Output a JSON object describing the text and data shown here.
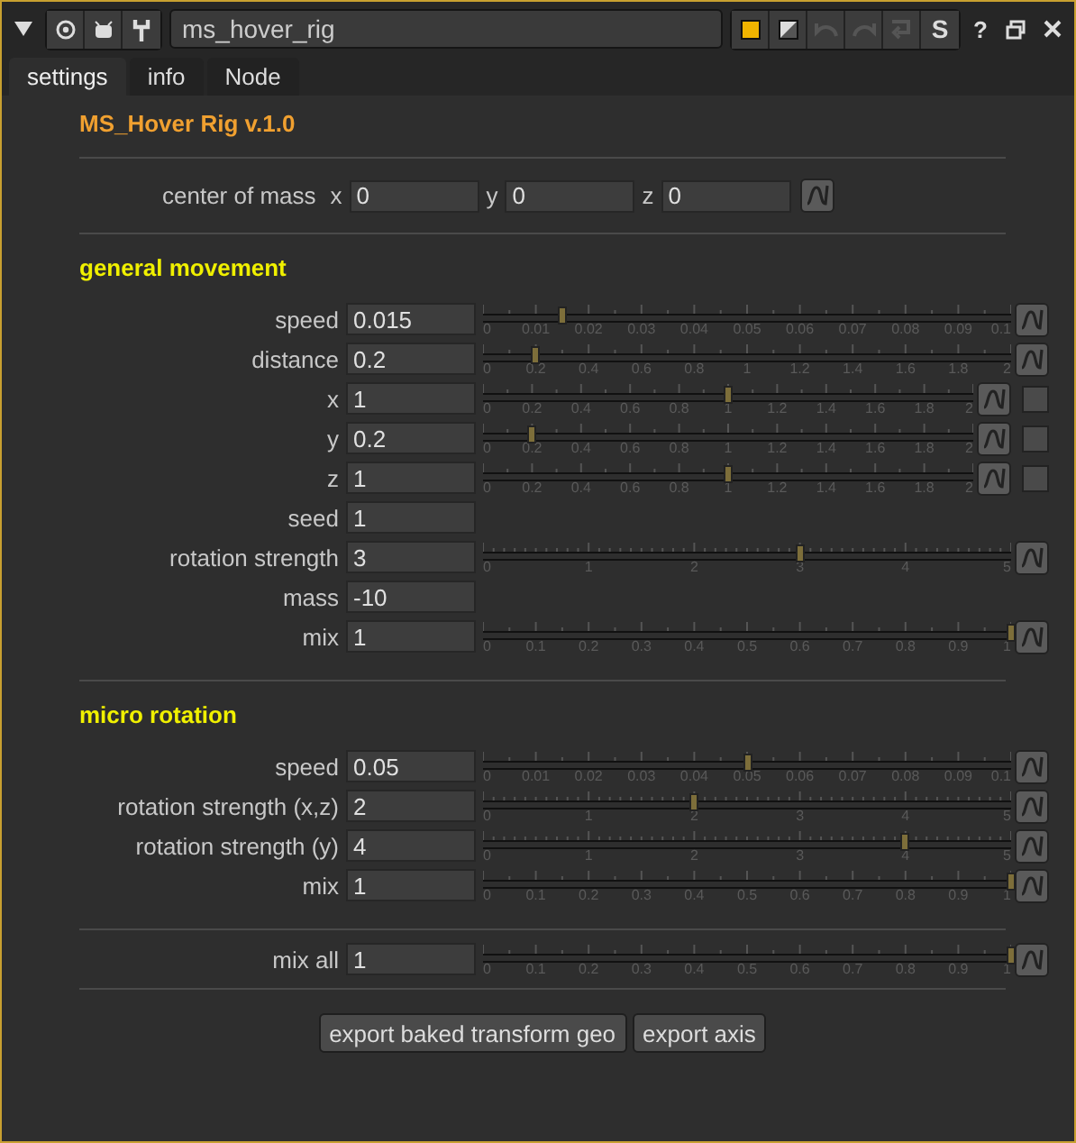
{
  "window": {
    "node_name": "ms_hover_rig",
    "s_label": "S",
    "help_label": "?"
  },
  "tabs": [
    {
      "label": "settings",
      "selected": true
    },
    {
      "label": "info",
      "selected": false
    },
    {
      "label": "Node",
      "selected": false
    }
  ],
  "title": "MS_Hover Rig v.1.0",
  "center_of_mass": {
    "label": "center of mass",
    "fields": [
      {
        "axis": "x",
        "value": "0"
      },
      {
        "axis": "y",
        "value": "0"
      },
      {
        "axis": "z",
        "value": "0"
      }
    ]
  },
  "sections": [
    {
      "heading": "general movement",
      "rows": [
        {
          "kind": "slider",
          "label": "speed",
          "value": "0.015",
          "level": 0.15,
          "ticks": [
            "0",
            "0.01",
            "0.02",
            "0.03",
            "0.04",
            "0.05",
            "0.06",
            "0.07",
            "0.08",
            "0.09",
            "0.1"
          ]
        },
        {
          "kind": "slider",
          "label": "distance",
          "value": "0.2",
          "level": 0.1,
          "ticks": [
            "0",
            "0.2",
            "0.4",
            "0.6",
            "0.8",
            "1",
            "1.2",
            "1.4",
            "1.6",
            "1.8",
            "2"
          ]
        },
        {
          "kind": "slider",
          "label": "x",
          "value": "1",
          "level": 0.5,
          "checked": false,
          "ticks": [
            "0",
            "0.2",
            "0.4",
            "0.6",
            "0.8",
            "1",
            "1.2",
            "1.4",
            "1.6",
            "1.8",
            "2"
          ]
        },
        {
          "kind": "slider",
          "label": "y",
          "value": "0.2",
          "level": 0.1,
          "checked": false,
          "ticks": [
            "0",
            "0.2",
            "0.4",
            "0.6",
            "0.8",
            "1",
            "1.2",
            "1.4",
            "1.6",
            "1.8",
            "2"
          ]
        },
        {
          "kind": "slider",
          "label": "z",
          "value": "1",
          "level": 0.5,
          "checked": false,
          "ticks": [
            "0",
            "0.2",
            "0.4",
            "0.6",
            "0.8",
            "1",
            "1.2",
            "1.4",
            "1.6",
            "1.8",
            "2"
          ]
        },
        {
          "kind": "input",
          "label": "seed",
          "value": "1"
        },
        {
          "kind": "slider",
          "label": "rotation strength",
          "value": "3",
          "level": 0.6,
          "ticks": [
            "0",
            "1",
            "2",
            "3",
            "4",
            "5"
          ]
        },
        {
          "kind": "input",
          "label": "mass",
          "value": "-10"
        },
        {
          "kind": "slider",
          "label": "mix",
          "value": "1",
          "level": 1,
          "ticks": [
            "0",
            "0.1",
            "0.2",
            "0.3",
            "0.4",
            "0.5",
            "0.6",
            "0.7",
            "0.8",
            "0.9",
            "1"
          ]
        }
      ]
    },
    {
      "heading": "micro rotation",
      "rows": [
        {
          "kind": "slider",
          "label": "speed",
          "value": "0.05",
          "level": 0.5,
          "ticks": [
            "0",
            "0.01",
            "0.02",
            "0.03",
            "0.04",
            "0.05",
            "0.06",
            "0.07",
            "0.08",
            "0.09",
            "0.1"
          ]
        },
        {
          "kind": "slider",
          "label": "rotation strength (x,z)",
          "value": "2",
          "level": 0.4,
          "ticks": [
            "0",
            "1",
            "2",
            "3",
            "4",
            "5"
          ]
        },
        {
          "kind": "slider",
          "label": "rotation strength (y)",
          "value": "4",
          "level": 0.8,
          "ticks": [
            "0",
            "1",
            "2",
            "3",
            "4",
            "5"
          ]
        },
        {
          "kind": "slider",
          "label": "mix",
          "value": "1",
          "level": 1,
          "ticks": [
            "0",
            "0.1",
            "0.2",
            "0.3",
            "0.4",
            "0.5",
            "0.6",
            "0.7",
            "0.8",
            "0.9",
            "1"
          ]
        }
      ]
    },
    {
      "rows": [
        {
          "kind": "slider",
          "label": "mix all",
          "value": "1",
          "level": 1,
          "ticks": [
            "0",
            "0.1",
            "0.2",
            "0.3",
            "0.4",
            "0.5",
            "0.6",
            "0.7",
            "0.8",
            "0.9",
            "1"
          ]
        }
      ]
    }
  ],
  "buttons": [
    "export baked transform geo",
    "export axis"
  ]
}
